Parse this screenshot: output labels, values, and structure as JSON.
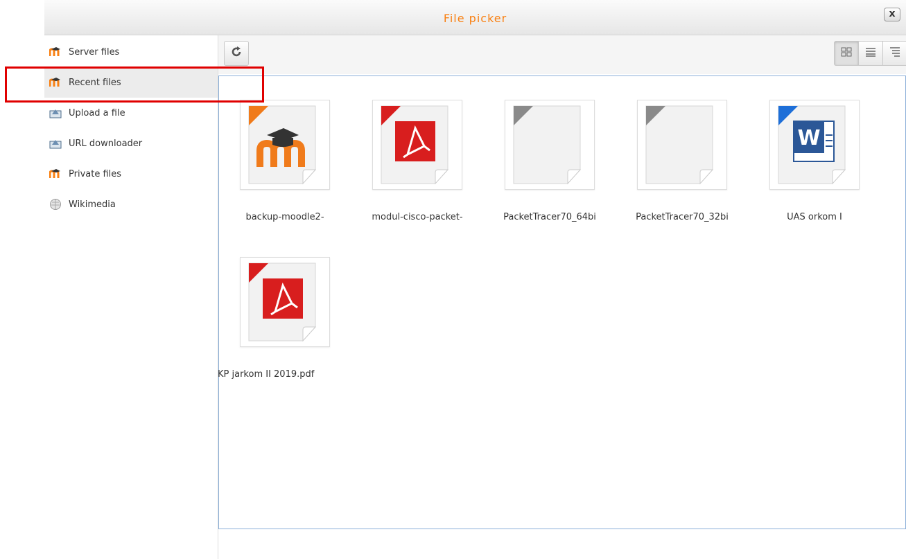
{
  "dialog": {
    "title": "File picker",
    "close_label": "x"
  },
  "sidebar": {
    "items": [
      {
        "label": "Server files",
        "icon": "moodle-icon",
        "active": false
      },
      {
        "label": "Recent files",
        "icon": "moodle-icon",
        "active": true
      },
      {
        "label": "Upload a file",
        "icon": "upload-icon",
        "active": false
      },
      {
        "label": "URL downloader",
        "icon": "upload-icon",
        "active": false
      },
      {
        "label": "Private files",
        "icon": "moodle-icon",
        "active": false
      },
      {
        "label": "Wikimedia",
        "icon": "wikimedia-icon",
        "active": false
      }
    ]
  },
  "toolbar": {
    "refresh_icon": "refresh-icon",
    "views": [
      "icon-view-icon",
      "list-view-icon",
      "tree-view-icon"
    ]
  },
  "files": [
    {
      "name": "backup-moodle2-",
      "type": "moodle-backup",
      "corner": "#f07b1b"
    },
    {
      "name": "modul-cisco-packet-",
      "type": "pdf",
      "corner": "#d81e1e"
    },
    {
      "name": "PacketTracer70_64bi",
      "type": "generic",
      "corner": "#8a8a8a"
    },
    {
      "name": "PacketTracer70_32bi",
      "type": "generic",
      "corner": "#8a8a8a"
    },
    {
      "name": "UAS orkom I",
      "type": "word",
      "corner": "#1e6fd8"
    },
    {
      "name": "KP jarkom II 2019.pdf",
      "type": "pdf",
      "corner": "#d81e1e"
    }
  ],
  "colors": {
    "title": "#f98012",
    "highlight": "#e00000",
    "filearea_border": "#8aaed8"
  }
}
